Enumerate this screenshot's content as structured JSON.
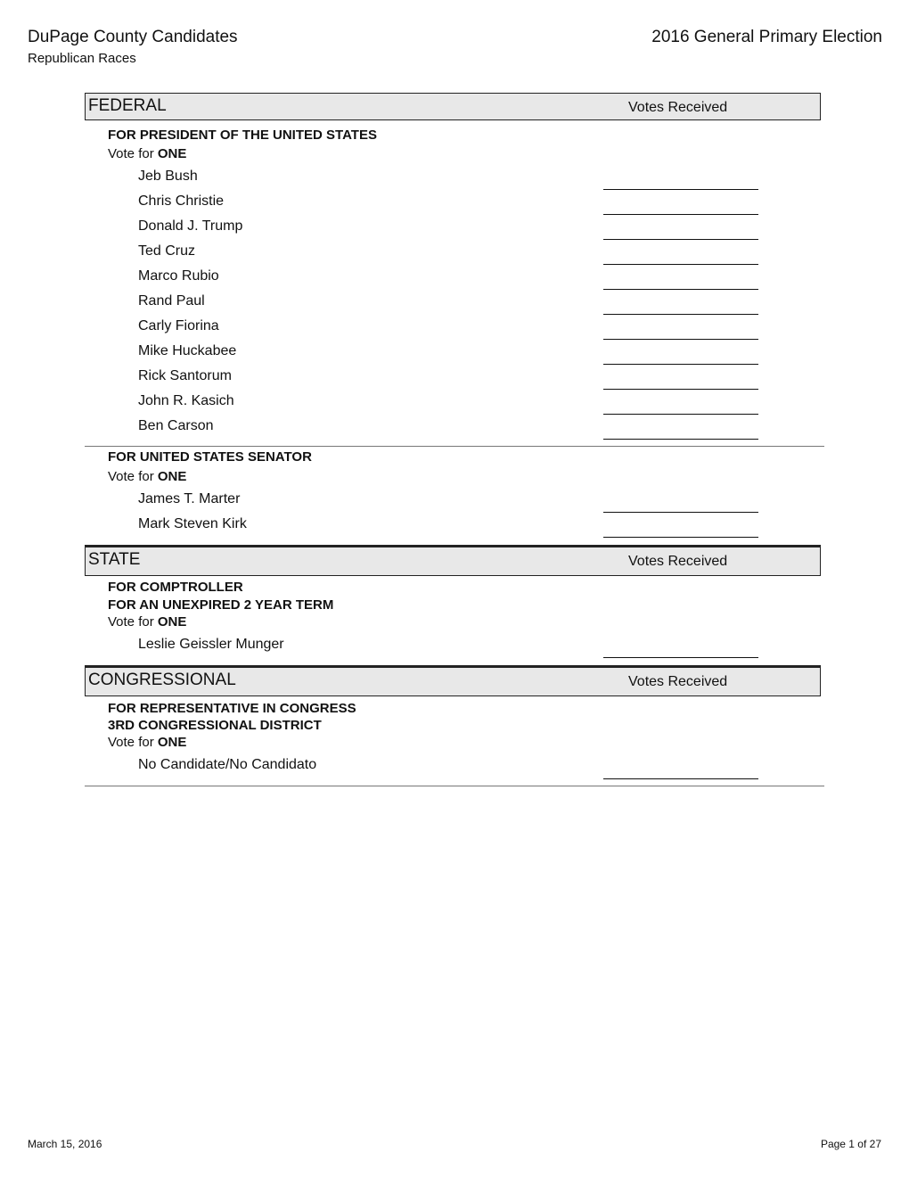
{
  "header": {
    "title": "DuPage County Candidates",
    "subtitle": "Republican Races",
    "election": "2016 General Primary Election"
  },
  "sections": [
    {
      "name": "FEDERAL",
      "votes_label": "Votes Received",
      "races": [
        {
          "title_lines": [
            "FOR PRESIDENT OF THE UNITED STATES"
          ],
          "vote_for_prefix": "Vote for",
          "vote_for_count": "ONE",
          "candidates": [
            "Jeb Bush",
            "Chris Christie",
            "Donald J. Trump",
            "Ted Cruz",
            "Marco Rubio",
            "Rand Paul",
            "Carly Fiorina",
            "Mike Huckabee",
            "Rick Santorum",
            "John R. Kasich",
            "Ben Carson"
          ]
        },
        {
          "title_lines": [
            "FOR UNITED STATES SENATOR"
          ],
          "vote_for_prefix": "Vote for",
          "vote_for_count": "ONE",
          "candidates": [
            "James T. Marter",
            "Mark Steven Kirk"
          ]
        }
      ]
    },
    {
      "name": "STATE",
      "votes_label": "Votes Received",
      "races": [
        {
          "title_lines": [
            "FOR COMPTROLLER",
            "FOR AN UNEXPIRED 2 YEAR TERM"
          ],
          "vote_for_prefix": "Vote for",
          "vote_for_count": "ONE",
          "candidates": [
            "Leslie Geissler Munger"
          ]
        }
      ]
    },
    {
      "name": "CONGRESSIONAL",
      "votes_label": "Votes Received",
      "races": [
        {
          "title_lines": [
            "FOR REPRESENTATIVE IN CONGRESS",
            "3RD CONGRESSIONAL DISTRICT"
          ],
          "vote_for_prefix": "Vote for",
          "vote_for_count": "ONE",
          "candidates": [
            "No Candidate/No Candidato"
          ]
        }
      ]
    }
  ],
  "footer": {
    "date": "March 15, 2016",
    "page": "Page 1 of 27"
  }
}
